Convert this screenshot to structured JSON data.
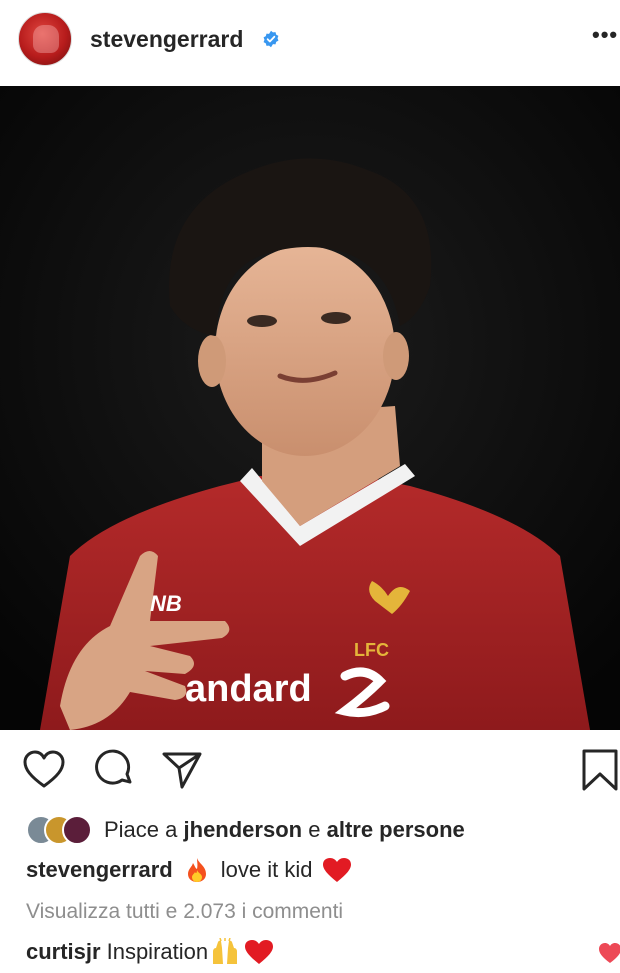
{
  "post": {
    "username": "stevengerrard",
    "verified": true,
    "photo": {
      "shirt_sponsor_text": "andard",
      "club_badge_text": "LFC"
    },
    "likes": {
      "prefix": "Piace a",
      "user": "jhenderson",
      "connector": "e",
      "others": "altre persone"
    },
    "caption": {
      "username": "stevengerrard",
      "text": "love it kid"
    },
    "view_all_comments": "Visualizza tutti e 2.073 i commenti",
    "comments": [
      {
        "username": "curtisjr",
        "text": "Inspiration"
      }
    ]
  },
  "colors": {
    "text": "#262626",
    "secondary_text": "#8e8e8e",
    "verified_blue": "#3897f0",
    "heart_red": "#ed4956",
    "shirt_red": "#a51f22"
  },
  "icons": [
    "verified-badge-icon",
    "more-options-icon",
    "like-heart-icon",
    "comment-icon",
    "share-icon",
    "bookmark-icon",
    "fire-emoji",
    "red-heart-emoji",
    "raised-hands-emoji",
    "comment-like-heart-icon"
  ]
}
